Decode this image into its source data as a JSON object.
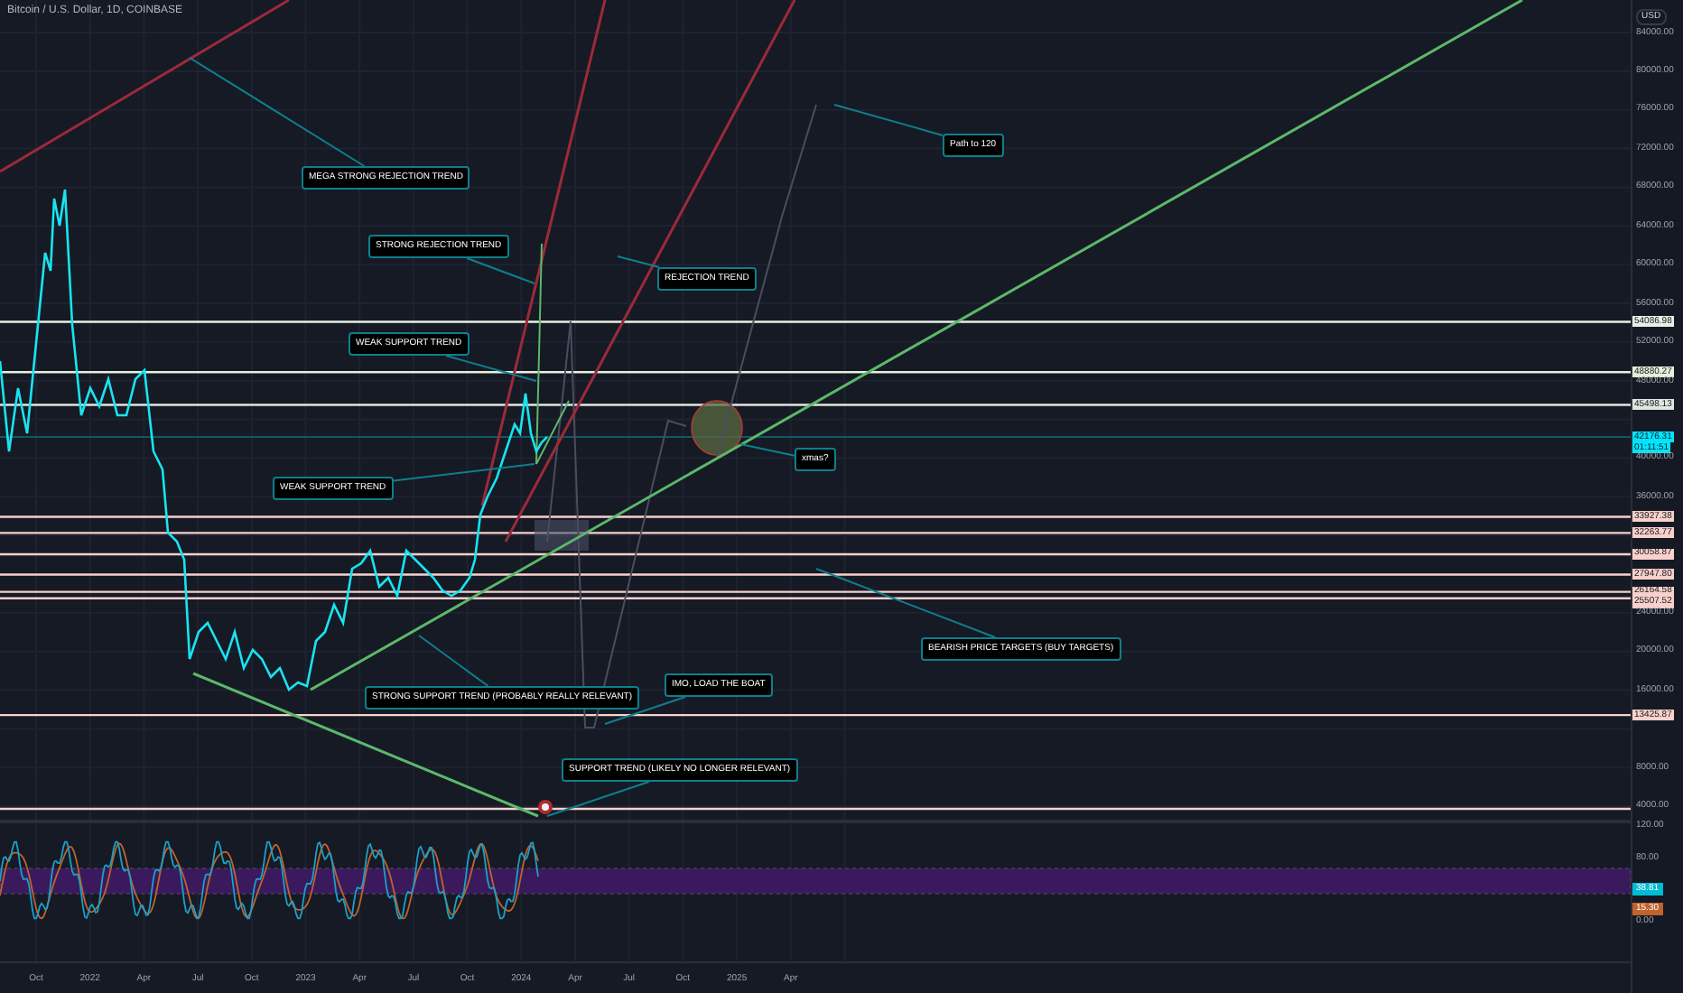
{
  "header": {
    "title": "Bitcoin / U.S. Dollar, 1D, COINBASE"
  },
  "price_axis": {
    "currency": "USD",
    "ticks": [
      "84000.00",
      "80000.00",
      "76000.00",
      "72000.00",
      "68000.00",
      "64000.00",
      "60000.00",
      "56000.00",
      "52000.00",
      "48000.00",
      "40000.00",
      "36000.00",
      "24000.00",
      "20000.00",
      "16000.00",
      "8000.00",
      "4000.00"
    ],
    "price_labels": [
      {
        "kind": "level",
        "text": "54086.98",
        "color": "#e8efe6"
      },
      {
        "kind": "level",
        "text": "48880.27",
        "color": "#e3f0dc"
      },
      {
        "kind": "level",
        "text": "45498.13",
        "color": "#dfe6e0"
      },
      {
        "kind": "current",
        "text": "42176.31",
        "color": "#00e5ff"
      },
      {
        "kind": "countdown",
        "text": "01:11:51",
        "color": "#00e5ff"
      },
      {
        "kind": "level",
        "text": "33927.38",
        "color": "#f8d0cc"
      },
      {
        "kind": "level",
        "text": "32263.77",
        "color": "#f8d0cc"
      },
      {
        "kind": "level",
        "text": "30058.87",
        "color": "#f8d0cc"
      },
      {
        "kind": "level",
        "text": "27947.80",
        "color": "#f8d0cc"
      },
      {
        "kind": "level",
        "text": "26164.58",
        "color": "#f8d0cc"
      },
      {
        "kind": "level",
        "text": "25507.52",
        "color": "#f8d0cc"
      },
      {
        "kind": "level",
        "text": "13425.87",
        "color": "#f8d0cc"
      }
    ]
  },
  "annotations": [
    {
      "text": "MEGA STRONG REJECTION TREND"
    },
    {
      "text": "STRONG REJECTION TREND"
    },
    {
      "text": "REJECTION TREND"
    },
    {
      "text": "WEAK SUPPORT TREND"
    },
    {
      "text": "WEAK SUPPORT TREND"
    },
    {
      "text": "Path to 120"
    },
    {
      "text": "xmas?"
    },
    {
      "text": "BEARISH PRICE TARGETS (BUY TARGETS)"
    },
    {
      "text": "STRONG SUPPORT TREND (PROBABLY REALLY RELEVANT)"
    },
    {
      "text": "IMO, LOAD THE BOAT"
    },
    {
      "text": "SUPPORT TREND (LIKELY NO LONGER RELEVANT)"
    }
  ],
  "oscillator": {
    "ticks": [
      "120.00",
      "80.00",
      "0.00"
    ],
    "value_labels": [
      {
        "text": "38.81",
        "color": "#00bcd4"
      },
      {
        "text": "15.30",
        "color": "#c0632c"
      }
    ]
  },
  "time_axis": {
    "ticks": [
      "Oct",
      "2022",
      "Apr",
      "Jul",
      "Oct",
      "2023",
      "Apr",
      "Jul",
      "Oct",
      "2024",
      "Apr",
      "Jul",
      "Oct",
      "2025",
      "Apr"
    ]
  }
}
